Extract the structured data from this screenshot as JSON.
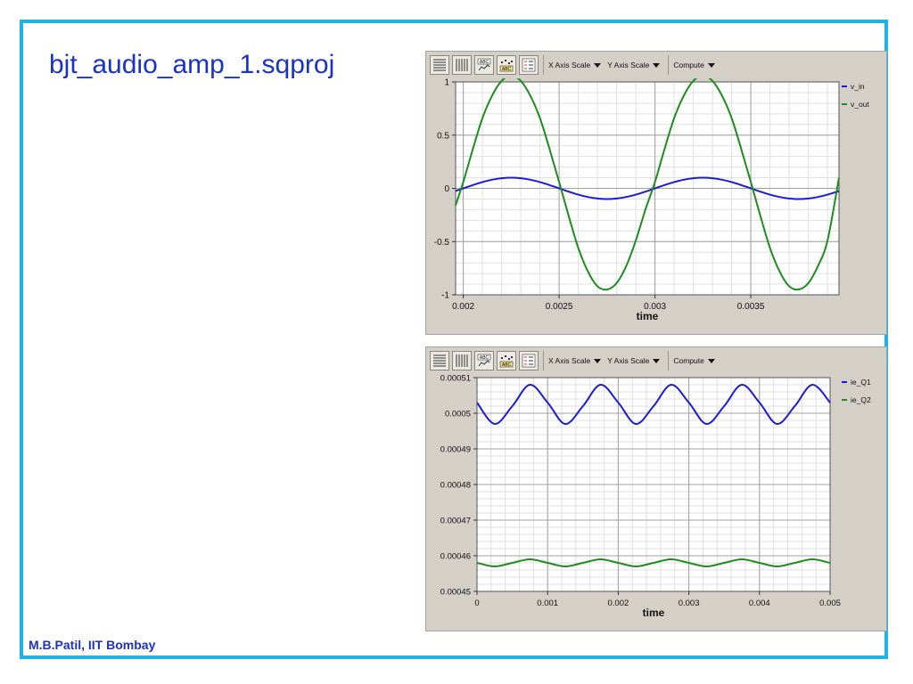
{
  "slide": {
    "title": "bjt_audio_amp_1.sqproj",
    "footer": "M.B.Patil, IIT Bombay",
    "frame_color": "#1cb4e6",
    "text_color": "#1a32c8"
  },
  "toolbar_common": {
    "icons": [
      "horizontal-grid-icon",
      "vertical-grid-icon",
      "label-abc-icon",
      "markers-icon",
      "legend-icon"
    ],
    "label_button_text": "ABC",
    "x_axis_scale_label": "X Axis Scale",
    "y_axis_scale_label": "Y Axis Scale",
    "compute_label": "Compute",
    "dropdown_icon": "triangle-down-icon"
  },
  "chart_data": [
    {
      "type": "line",
      "title": "",
      "xlabel": "time",
      "ylabel": "",
      "xlim": [
        0.00196,
        0.00396
      ],
      "ylim": [
        -1.0,
        1.0
      ],
      "x_ticks": [
        0.002,
        0.0025,
        0.003,
        0.0035
      ],
      "x_tick_labels": [
        "0.002",
        "0.0025",
        "0.003",
        "0.0035"
      ],
      "y_ticks": [
        1,
        0.5,
        0,
        -0.5,
        -1
      ],
      "y_tick_labels": [
        "1",
        "0.5",
        "0",
        "-0.5",
        "-1"
      ],
      "grid": true,
      "legend": "right",
      "series": [
        {
          "name": "v_in",
          "color": "#1a1adc",
          "x": [
            0.00196,
            0.002,
            0.00205,
            0.0021,
            0.00215,
            0.0022,
            0.00225,
            0.0023,
            0.00235,
            0.0024,
            0.00245,
            0.0025,
            0.00255,
            0.0026,
            0.00265,
            0.0027,
            0.00275,
            0.0028,
            0.00285,
            0.0029,
            0.00295,
            0.003,
            0.00305,
            0.0031,
            0.00315,
            0.0032,
            0.00325,
            0.0033,
            0.00335,
            0.0034,
            0.00345,
            0.0035,
            0.00355,
            0.0036,
            0.00365,
            0.0037,
            0.00375,
            0.0038,
            0.00385,
            0.0039,
            0.00396
          ],
          "y": [
            -0.025,
            0.0,
            0.031,
            0.059,
            0.081,
            0.095,
            0.1,
            0.095,
            0.081,
            0.059,
            0.031,
            0.0,
            -0.031,
            -0.059,
            -0.081,
            -0.095,
            -0.1,
            -0.095,
            -0.081,
            -0.059,
            -0.031,
            0.0,
            0.031,
            0.059,
            0.081,
            0.095,
            0.1,
            0.095,
            0.081,
            0.059,
            0.031,
            0.0,
            -0.031,
            -0.059,
            -0.081,
            -0.095,
            -0.1,
            -0.095,
            -0.081,
            -0.059,
            -0.025
          ]
        },
        {
          "name": "v_out",
          "color": "#1e8c1e",
          "x": [
            0.00196,
            0.002,
            0.00205,
            0.0021,
            0.00215,
            0.0022,
            0.00225,
            0.0023,
            0.00235,
            0.0024,
            0.00245,
            0.0025,
            0.00255,
            0.0026,
            0.00265,
            0.0027,
            0.00275,
            0.0028,
            0.00285,
            0.0029,
            0.00295,
            0.003,
            0.00305,
            0.0031,
            0.00315,
            0.0032,
            0.00325,
            0.0033,
            0.00335,
            0.0034,
            0.00345,
            0.0035,
            0.00355,
            0.0036,
            0.00365,
            0.0037,
            0.00375,
            0.0038,
            0.00385,
            0.0039,
            0.00396
          ],
          "y": [
            -0.16,
            0.06,
            0.37,
            0.66,
            0.87,
            1.01,
            1.06,
            1.01,
            0.87,
            0.66,
            0.37,
            0.06,
            -0.26,
            -0.56,
            -0.78,
            -0.92,
            -0.95,
            -0.89,
            -0.73,
            -0.49,
            -0.2,
            0.06,
            0.37,
            0.66,
            0.87,
            1.01,
            1.06,
            1.01,
            0.87,
            0.66,
            0.37,
            0.06,
            -0.26,
            -0.56,
            -0.78,
            -0.92,
            -0.95,
            -0.89,
            -0.73,
            -0.49,
            0.1
          ]
        }
      ]
    },
    {
      "type": "line",
      "title": "",
      "xlabel": "time",
      "ylabel": "",
      "xlim": [
        0,
        0.005
      ],
      "ylim": [
        0.00045,
        0.00051
      ],
      "x_ticks": [
        0,
        0.001,
        0.002,
        0.003,
        0.004,
        0.005
      ],
      "x_tick_labels": [
        "0",
        "0.001",
        "0.002",
        "0.003",
        "0.004",
        "0.005"
      ],
      "y_ticks": [
        0.00051,
        0.0005,
        0.00049,
        0.00048,
        0.00047,
        0.00046,
        0.00045
      ],
      "y_tick_labels": [
        "0.00051",
        "0.0005",
        "0.00049",
        "0.00048",
        "0.00047",
        "0.00046",
        "0.00045"
      ],
      "grid": true,
      "legend": "right",
      "series": [
        {
          "name": "ie_Q1",
          "color": "#1a1adc",
          "x": [
            0,
            0.00025,
            0.0005,
            0.00075,
            0.001,
            0.00125,
            0.0015,
            0.00175,
            0.002,
            0.00225,
            0.0025,
            0.00275,
            0.003,
            0.00325,
            0.0035,
            0.00375,
            0.004,
            0.00425,
            0.0045,
            0.00475,
            0.005
          ],
          "y": [
            0.000503,
            0.000497,
            0.000502,
            0.000508,
            0.000503,
            0.000497,
            0.000502,
            0.000508,
            0.000503,
            0.000497,
            0.000502,
            0.000508,
            0.000503,
            0.000497,
            0.000502,
            0.000508,
            0.000503,
            0.000497,
            0.000502,
            0.000508,
            0.000503
          ]
        },
        {
          "name": "ie_Q2",
          "color": "#1e8c1e",
          "x": [
            0,
            0.00025,
            0.0005,
            0.00075,
            0.001,
            0.00125,
            0.0015,
            0.00175,
            0.002,
            0.00225,
            0.0025,
            0.00275,
            0.003,
            0.00325,
            0.0035,
            0.00375,
            0.004,
            0.00425,
            0.0045,
            0.00475,
            0.005
          ],
          "y": [
            0.000458,
            0.000457,
            0.000458,
            0.000459,
            0.000458,
            0.000457,
            0.000458,
            0.000459,
            0.000458,
            0.000457,
            0.000458,
            0.000459,
            0.000458,
            0.000457,
            0.000458,
            0.000459,
            0.000458,
            0.000457,
            0.000458,
            0.000459,
            0.000458
          ]
        }
      ]
    }
  ]
}
